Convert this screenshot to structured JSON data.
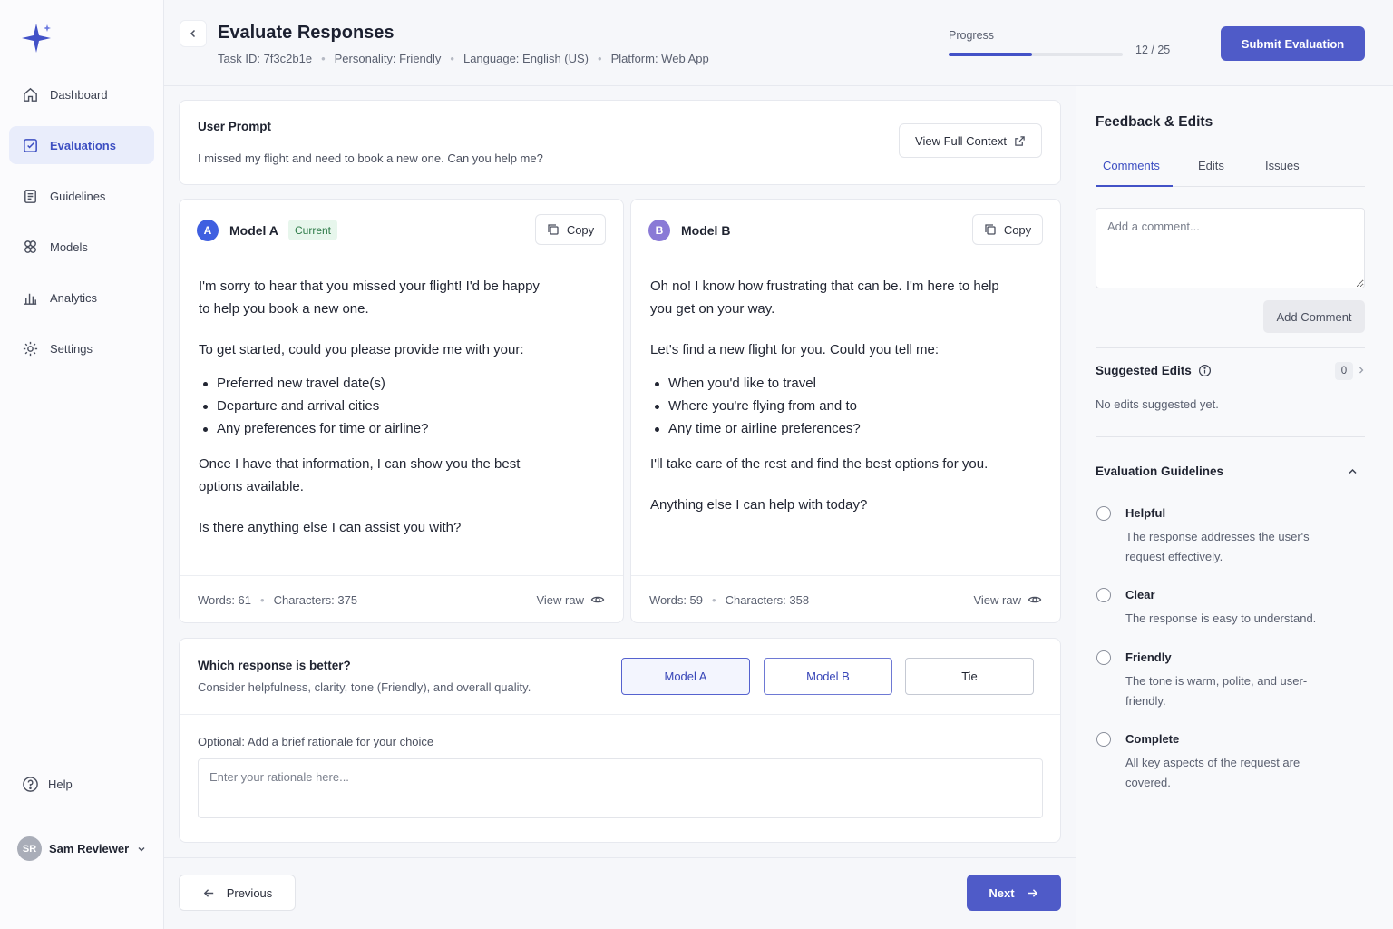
{
  "sidebar": {
    "items": [
      {
        "label": "Dashboard",
        "icon": "home-icon"
      },
      {
        "label": "Evaluations",
        "icon": "clipboard-check-icon"
      },
      {
        "label": "Guidelines",
        "icon": "document-icon"
      },
      {
        "label": "Models",
        "icon": "cube-icon"
      },
      {
        "label": "Analytics",
        "icon": "bar-chart-icon"
      },
      {
        "label": "Settings",
        "icon": "gear-icon"
      }
    ],
    "active_item": "Evaluations",
    "help_label": "Help",
    "user": {
      "initials": "SR",
      "name": "Sam Reviewer"
    }
  },
  "header": {
    "title": "Evaluate Responses",
    "meta": {
      "task_id": "Task ID: 7f3c2b1e",
      "personality": "Personality: Friendly",
      "language": "Language: English (US)",
      "platform": "Platform: Web App"
    },
    "progress_label": "Progress",
    "progress_current": 12,
    "progress_total": 25,
    "progress_text": "12 / 25",
    "submit_label": "Submit Evaluation"
  },
  "prompt": {
    "title": "User Prompt",
    "text": "I missed my flight and need to book a new one. Can you help me?",
    "view_context_label": "View Full Context"
  },
  "model_a": {
    "badge": "A",
    "name": "Model A",
    "tag": "Current",
    "copy_label": "Copy",
    "p1": "I'm sorry to hear that you missed your flight! I'd be happy to help you book a new one.",
    "p2": "To get started, could you please provide me with your:",
    "bullets": [
      "Preferred new travel date(s)",
      "Departure and arrival cities",
      "Any preferences for time or airline?"
    ],
    "p3": "Once I have that information, I can show you the best options available.",
    "p4": "Is there anything else I can assist you with?",
    "words": "Words: 61",
    "characters": "Characters: 375",
    "view_raw": "View raw"
  },
  "model_b": {
    "badge": "B",
    "name": "Model B",
    "copy_label": "Copy",
    "p1": "Oh no! I know how frustrating that can be. I'm here to help you get on your way.",
    "p2": "Let's find a new flight for you. Could you tell me:",
    "bullets": [
      "When you'd like to travel",
      "Where you're flying from and to",
      "Any time or airline preferences?"
    ],
    "p3": "I'll take care of the rest and find the best options for you.",
    "p4": "Anything else I can help with today?",
    "words": "Words: 59",
    "characters": "Characters: 358",
    "view_raw": "View raw"
  },
  "choice": {
    "title": "Which response is better?",
    "subtitle": "Consider helpfulness, clarity, tone (Friendly), and overall quality.",
    "options": [
      "Model A",
      "Model B",
      "Tie"
    ],
    "selected": "Model A",
    "rationale_label": "Optional: Add a brief rationale for your choice",
    "rationale_placeholder": "Enter your rationale here..."
  },
  "nav_buttons": {
    "previous": "Previous",
    "next": "Next"
  },
  "panel": {
    "title": "Feedback & Edits",
    "tabs": [
      "Comments",
      "Edits",
      "Issues"
    ],
    "active_tab": "Comments",
    "comment_placeholder": "Add a comment...",
    "add_comment_label": "Add Comment",
    "suggested_edits_title": "Suggested Edits",
    "suggested_edits_count": "0",
    "suggested_edits_empty": "No edits suggested yet.",
    "guidelines_title": "Evaluation Guidelines",
    "guidelines": [
      {
        "name": "Helpful",
        "desc": "The response addresses the user's request effectively."
      },
      {
        "name": "Clear",
        "desc": "The response is easy to understand."
      },
      {
        "name": "Friendly",
        "desc": "The tone is warm, polite, and user-friendly."
      },
      {
        "name": "Complete",
        "desc": "All key aspects of the request are covered."
      }
    ]
  },
  "colors": {
    "accent": "#4f5bc8",
    "model_a_badge": "#3f5fe0",
    "model_b_badge": "#8a7ad6",
    "current_tag_bg": "#e7f6ec"
  }
}
